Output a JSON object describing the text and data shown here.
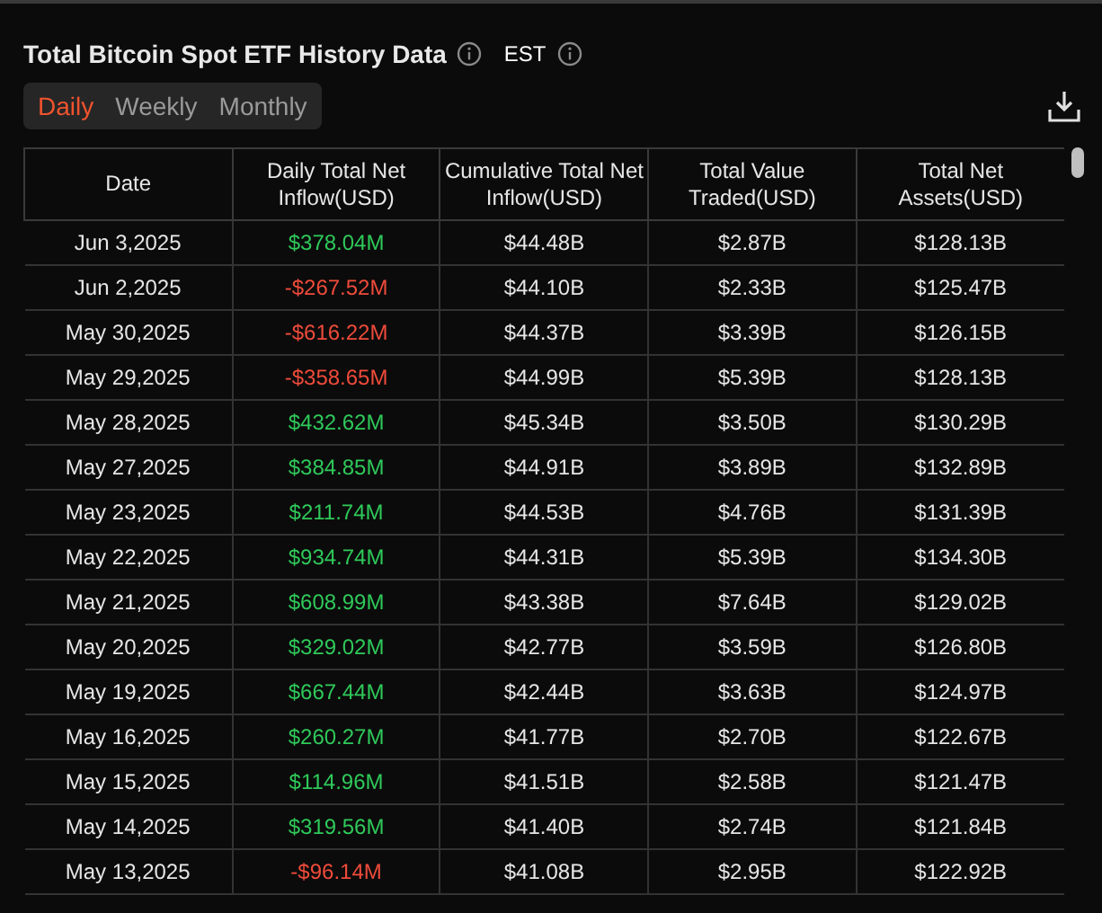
{
  "header": {
    "title": "Total Bitcoin Spot ETF History Data",
    "timezone": "EST"
  },
  "tabs": [
    {
      "label": "Daily",
      "selected": true
    },
    {
      "label": "Weekly",
      "selected": false
    },
    {
      "label": "Monthly",
      "selected": false
    }
  ],
  "table": {
    "columns": [
      "Date",
      "Daily Total Net Inflow(USD)",
      "Cumulative Total Net Inflow(USD)",
      "Total Value Traded(USD)",
      "Total Net Assets(USD)"
    ],
    "rows": [
      {
        "date": "Jun 3,2025",
        "inflow": "$378.04M",
        "kind": "gain",
        "cumulative": "$44.48B",
        "traded": "$2.87B",
        "assets": "$128.13B"
      },
      {
        "date": "Jun 2,2025",
        "inflow": "-$267.52M",
        "kind": "loss",
        "cumulative": "$44.10B",
        "traded": "$2.33B",
        "assets": "$125.47B"
      },
      {
        "date": "May 30,2025",
        "inflow": "-$616.22M",
        "kind": "loss",
        "cumulative": "$44.37B",
        "traded": "$3.39B",
        "assets": "$126.15B"
      },
      {
        "date": "May 29,2025",
        "inflow": "-$358.65M",
        "kind": "loss",
        "cumulative": "$44.99B",
        "traded": "$5.39B",
        "assets": "$128.13B"
      },
      {
        "date": "May 28,2025",
        "inflow": "$432.62M",
        "kind": "gain",
        "cumulative": "$45.34B",
        "traded": "$3.50B",
        "assets": "$130.29B"
      },
      {
        "date": "May 27,2025",
        "inflow": "$384.85M",
        "kind": "gain",
        "cumulative": "$44.91B",
        "traded": "$3.89B",
        "assets": "$132.89B"
      },
      {
        "date": "May 23,2025",
        "inflow": "$211.74M",
        "kind": "gain",
        "cumulative": "$44.53B",
        "traded": "$4.76B",
        "assets": "$131.39B"
      },
      {
        "date": "May 22,2025",
        "inflow": "$934.74M",
        "kind": "gain",
        "cumulative": "$44.31B",
        "traded": "$5.39B",
        "assets": "$134.30B"
      },
      {
        "date": "May 21,2025",
        "inflow": "$608.99M",
        "kind": "gain",
        "cumulative": "$43.38B",
        "traded": "$7.64B",
        "assets": "$129.02B"
      },
      {
        "date": "May 20,2025",
        "inflow": "$329.02M",
        "kind": "gain",
        "cumulative": "$42.77B",
        "traded": "$3.59B",
        "assets": "$126.80B"
      },
      {
        "date": "May 19,2025",
        "inflow": "$667.44M",
        "kind": "gain",
        "cumulative": "$42.44B",
        "traded": "$3.63B",
        "assets": "$124.97B"
      },
      {
        "date": "May 16,2025",
        "inflow": "$260.27M",
        "kind": "gain",
        "cumulative": "$41.77B",
        "traded": "$2.70B",
        "assets": "$122.67B"
      },
      {
        "date": "May 15,2025",
        "inflow": "$114.96M",
        "kind": "gain",
        "cumulative": "$41.51B",
        "traded": "$2.58B",
        "assets": "$121.47B"
      },
      {
        "date": "May 14,2025",
        "inflow": "$319.56M",
        "kind": "gain",
        "cumulative": "$41.40B",
        "traded": "$2.74B",
        "assets": "$121.84B"
      },
      {
        "date": "May 13,2025",
        "inflow": "-$96.14M",
        "kind": "loss",
        "cumulative": "$41.08B",
        "traded": "$2.95B",
        "assets": "$122.92B"
      }
    ]
  }
}
